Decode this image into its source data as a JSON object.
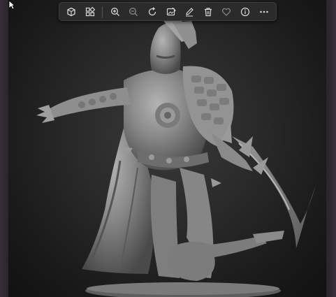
{
  "toolbar": {
    "buttons_left": [
      {
        "icon": "rotate-view-icon"
      },
      {
        "icon": "apps-grid-icon"
      }
    ],
    "buttons_right": [
      {
        "icon": "zoom-in-icon"
      },
      {
        "icon": "zoom-out-icon"
      },
      {
        "icon": "rotate-icon"
      },
      {
        "icon": "edit-image-icon"
      },
      {
        "icon": "draw-icon"
      },
      {
        "icon": "delete-icon"
      },
      {
        "icon": "favorite-icon"
      },
      {
        "icon": "info-icon"
      },
      {
        "icon": "more-options-icon"
      }
    ]
  },
  "colors": {
    "toolbar_bg": "#2b2b2b",
    "icon": "#d8d8d8",
    "sculpt": "#8c8c8c",
    "frame": "#3a2f3c"
  }
}
